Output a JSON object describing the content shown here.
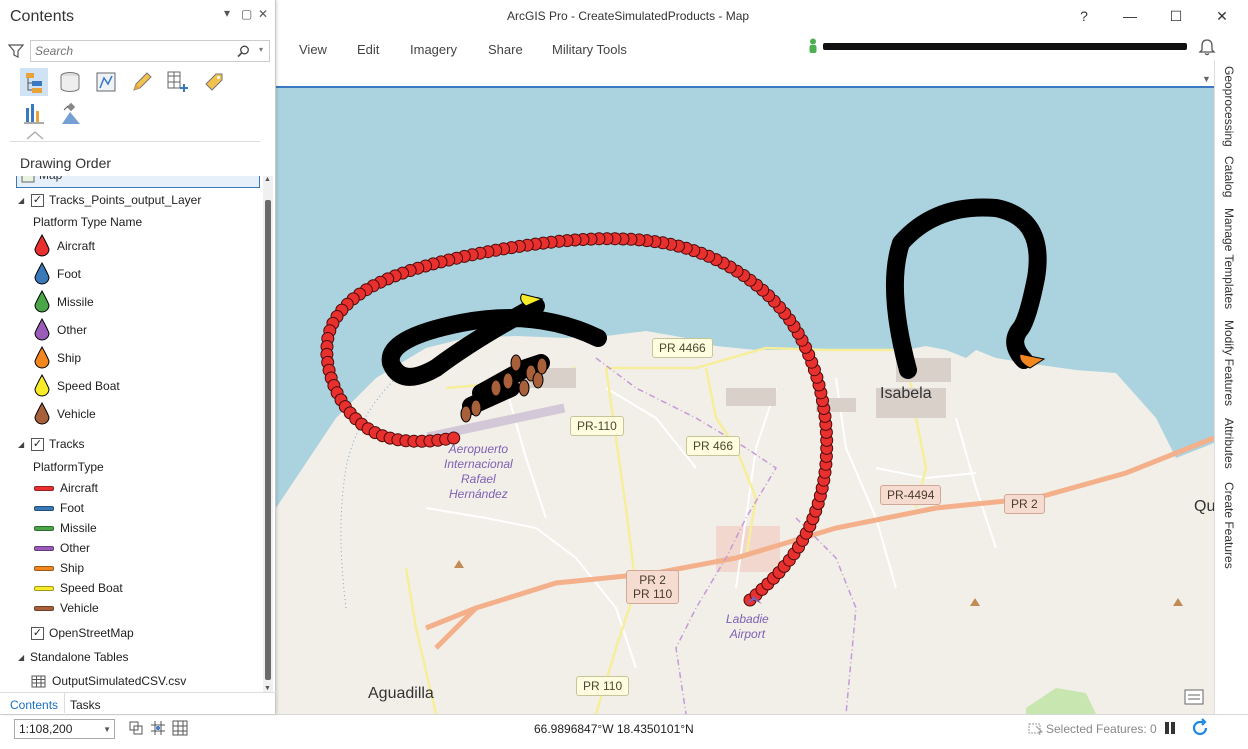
{
  "window": {
    "title": "ArcGIS Pro - CreateSimulatedProducts - Map",
    "help": "?",
    "minimize": "—",
    "maximize": "☐",
    "close": "✕"
  },
  "ribbon": {
    "tabs": [
      "View",
      "Edit",
      "Imagery",
      "Share",
      "Military Tools"
    ]
  },
  "contents": {
    "title": "Contents",
    "pin": "▾",
    "restore": "▢",
    "close": "✕",
    "search_placeholder": "Search",
    "tools": [
      "list-by-drawing-order-icon",
      "list-by-source-icon",
      "list-by-selection-icon",
      "list-by-editing-icon",
      "list-by-snapping-icon",
      "list-by-labeling-icon",
      "list-by-charts-icon",
      "list-by-perspective-imagery-icon"
    ],
    "view_heading": "Drawing Order",
    "map_item": "Map",
    "layers": [
      {
        "name": "Tracks_Points_output_Layer",
        "checked": true,
        "field": "Platform Type Name",
        "classes": [
          {
            "label": "Aircraft",
            "color": "#e8302e"
          },
          {
            "label": "Foot",
            "color": "#3a78b8"
          },
          {
            "label": "Missile",
            "color": "#4aa647"
          },
          {
            "label": "Other",
            "color": "#9a5cb8"
          },
          {
            "label": "Ship",
            "color": "#f2871f"
          },
          {
            "label": "Speed Boat",
            "color": "#f8ec28"
          },
          {
            "label": "Vehicle",
            "color": "#a8603a"
          }
        ]
      },
      {
        "name": "Tracks",
        "checked": true,
        "field": "PlatformType",
        "classes": [
          {
            "label": "Aircraft",
            "color": "#e8302e"
          },
          {
            "label": "Foot",
            "color": "#3a78b8"
          },
          {
            "label": "Missile",
            "color": "#4aa647"
          },
          {
            "label": "Other",
            "color": "#9a5cb8"
          },
          {
            "label": "Ship",
            "color": "#f2871f"
          },
          {
            "label": "Speed Boat",
            "color": "#f8ec28"
          },
          {
            "label": "Vehicle",
            "color": "#a8603a"
          }
        ]
      }
    ],
    "basemap": "OpenStreetMap",
    "standalone_heading": "Standalone Tables",
    "table": "OutputSimulatedCSV.csv",
    "bottom_tabs": [
      "Contents",
      "Tasks"
    ]
  },
  "map": {
    "places": {
      "isabela": "Isabela",
      "aguadilla": "Aguadilla",
      "quebradillas_partial": "Qu",
      "airport1": "Aeropuerto\nInternacional\nRafael\nHernández",
      "airport2": "Labadie\nAirport"
    },
    "roads": {
      "pr4466": "PR 4466",
      "pr110a": "PR-110",
      "pr466": "PR 466",
      "pr4494": "PR-4494",
      "pr2a": "PR 2",
      "pr2b": "PR 2\nPR 110",
      "pr110b": "PR 110"
    }
  },
  "right_dock": {
    "tabs": [
      "Geoprocessing",
      "Catalog",
      "Manage Templates",
      "Modify Features",
      "Attributes",
      "Create Features"
    ]
  },
  "status": {
    "scale": "1:108,200",
    "coordinates": "66.9896847°W 18.4350101°N",
    "selected_features": "Selected Features: 0"
  },
  "colors": {
    "accent": "#3a78c2",
    "water": "#aad3df",
    "land": "#f2efe9"
  }
}
